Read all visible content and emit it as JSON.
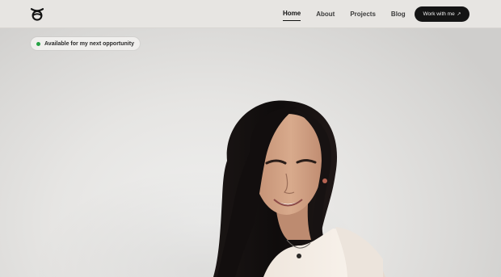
{
  "header": {
    "logo_icon": "mustache-face-icon",
    "nav": [
      {
        "label": "Home",
        "active": true
      },
      {
        "label": "About",
        "active": false
      },
      {
        "label": "Projects",
        "active": false
      },
      {
        "label": "Blog",
        "active": false
      }
    ],
    "cta": {
      "label": "Work with me",
      "icon": "arrow-up-right-icon",
      "arrow": "↗"
    }
  },
  "hero": {
    "status_badge": {
      "label": "Available for my next opportunity",
      "color": "#25a244"
    },
    "portrait": "portrait-photo"
  },
  "colors": {
    "background": "#e7e5e2",
    "cta_bg": "#141414",
    "status_green": "#25a244"
  }
}
